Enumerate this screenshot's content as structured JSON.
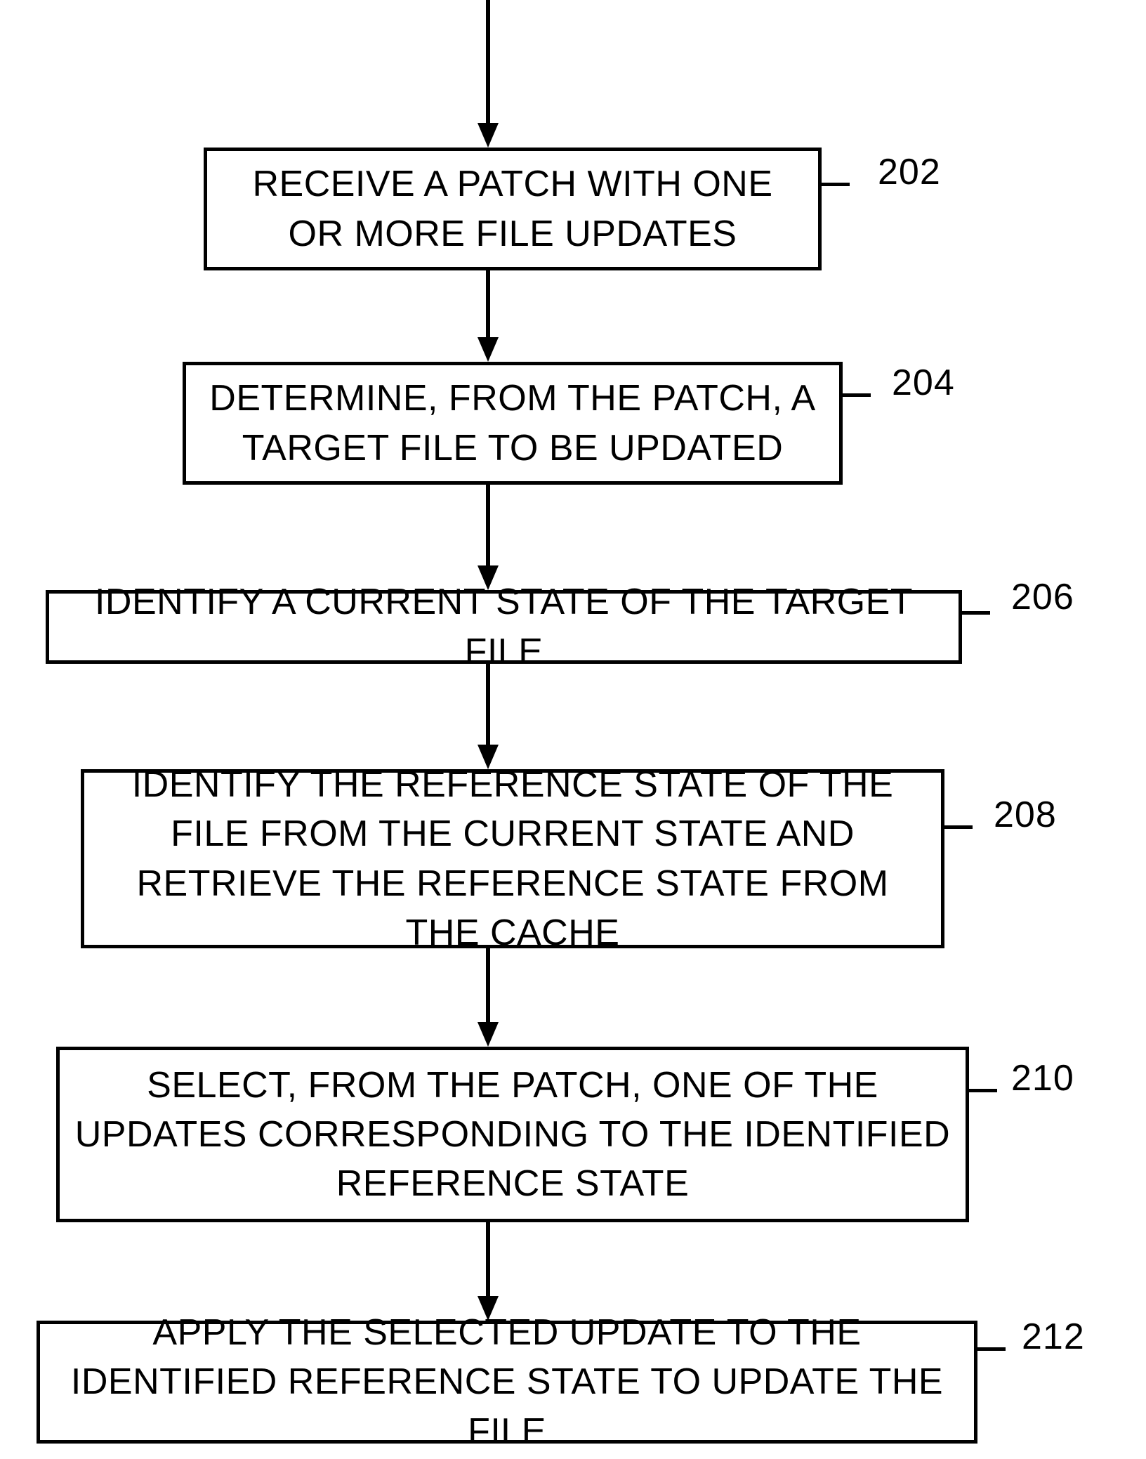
{
  "chart_data": {
    "type": "flowchart",
    "direction": "top-to-bottom",
    "nodes": [
      {
        "id": "202",
        "label": "RECEIVE A PATCH WITH ONE OR MORE FILE UPDATES"
      },
      {
        "id": "204",
        "label": "DETERMINE, FROM THE PATCH, A TARGET FILE TO BE UPDATED"
      },
      {
        "id": "206",
        "label": "IDENTIFY A CURRENT STATE OF THE TARGET FILE"
      },
      {
        "id": "208",
        "label": "IDENTIFY THE REFERENCE STATE OF THE FILE FROM THE CURRENT STATE AND RETRIEVE THE REFERENCE STATE FROM THE CACHE"
      },
      {
        "id": "210",
        "label": "SELECT, FROM THE PATCH, ONE OF THE UPDATES CORRESPONDING TO THE IDENTIFIED REFERENCE STATE"
      },
      {
        "id": "212",
        "label": "APPLY THE SELECTED UPDATE TO THE IDENTIFIED REFERENCE STATE TO UPDATE THE FILE"
      }
    ],
    "edges": [
      {
        "from": "start",
        "to": "202"
      },
      {
        "from": "202",
        "to": "204"
      },
      {
        "from": "204",
        "to": "206"
      },
      {
        "from": "206",
        "to": "208"
      },
      {
        "from": "208",
        "to": "210"
      },
      {
        "from": "210",
        "to": "212"
      }
    ]
  }
}
